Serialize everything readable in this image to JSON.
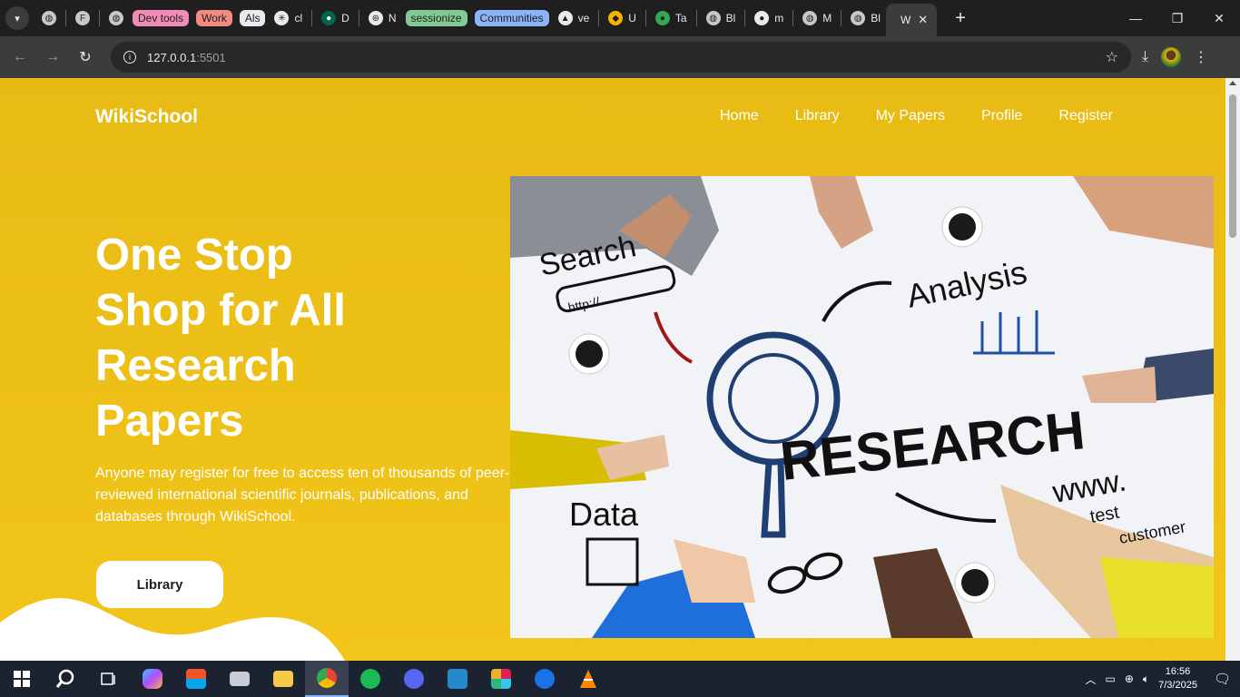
{
  "browser": {
    "tab_groups": [
      {
        "label": "Dev tools",
        "color": "#f28bb6"
      },
      {
        "label": "Work",
        "color": "#f28b82"
      },
      {
        "label": "Als",
        "color": "#e8eaed"
      },
      {
        "label": "sessionize",
        "color": "#81c995"
      },
      {
        "label": "Communities",
        "color": "#8ab4f8"
      }
    ],
    "tabs": [
      {
        "label": "cl"
      },
      {
        "label": "D"
      },
      {
        "label": "N"
      },
      {
        "label": "ve"
      },
      {
        "label": "U"
      },
      {
        "label": "Ta"
      },
      {
        "label": "Bl"
      },
      {
        "label": "m"
      },
      {
        "label": "M"
      },
      {
        "label": "Bl"
      }
    ],
    "active_tab": {
      "label": "W",
      "close": "✕"
    },
    "new_tab": "+",
    "url_host": "127.0.0.1",
    "url_port": ":5501"
  },
  "site": {
    "brand": "WikiSchool",
    "nav": [
      "Home",
      "Library",
      "My Papers",
      "Profile",
      "Register"
    ],
    "hero": {
      "title_lines": [
        "One Stop",
        "Shop for All",
        "Research",
        "Papers"
      ],
      "description": "Anyone may register for free to access ten of thousands of peer-reviewed international scientific journals, publications, and databases through WikiSchool.",
      "button": "Library"
    },
    "image_words": {
      "search": "Search",
      "http": "http://",
      "analysis": "Analysis",
      "research": "RESEARCH",
      "data": "Data",
      "www": "www.",
      "test": "test",
      "customer": "customer"
    },
    "colors": {
      "background": "#f0c419",
      "text": "#ffffff",
      "button_bg": "#ffffff"
    }
  },
  "taskbar": {
    "time": "16:56",
    "date": "7/3/2025"
  }
}
